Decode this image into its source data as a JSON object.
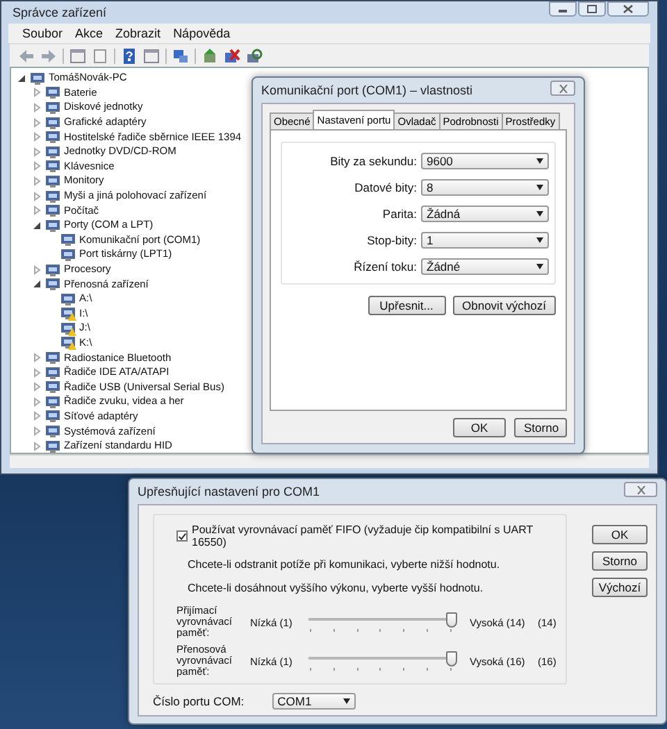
{
  "device_manager": {
    "title": "Správce zařízení",
    "menu": [
      "Soubor",
      "Akce",
      "Zobrazit",
      "Nápověda"
    ],
    "tree": {
      "label": "TomášNovák-PC",
      "expanded": true,
      "children": [
        {
          "label": "Baterie",
          "expanded": false
        },
        {
          "label": "Diskové jednotky",
          "expanded": false
        },
        {
          "label": "Grafické adaptéry",
          "expanded": false
        },
        {
          "label": "Hostitelské řadiče sběrnice IEEE 1394",
          "expanded": false
        },
        {
          "label": "Jednotky DVD/CD-ROM",
          "expanded": false
        },
        {
          "label": "Klávesnice",
          "expanded": false
        },
        {
          "label": "Monitory",
          "expanded": false
        },
        {
          "label": "Myši a jiná polohovací zařízení",
          "expanded": false
        },
        {
          "label": "Počítač",
          "expanded": false
        },
        {
          "label": "Porty (COM a LPT)",
          "expanded": true,
          "children": [
            {
              "label": "Komunikační port (COM1)",
              "warning": false
            },
            {
              "label": "Port tiskárny (LPT1)",
              "warning": false
            }
          ]
        },
        {
          "label": "Procesory",
          "expanded": false
        },
        {
          "label": "Přenosná zařízení",
          "expanded": true,
          "children": [
            {
              "label": "A:\\",
              "warning": false
            },
            {
              "label": "I:\\",
              "warning": true
            },
            {
              "label": "J:\\",
              "warning": true
            },
            {
              "label": "K:\\",
              "warning": true
            }
          ]
        },
        {
          "label": "Radiostanice Bluetooth",
          "expanded": false
        },
        {
          "label": "Řadiče IDE ATA/ATAPI",
          "expanded": false
        },
        {
          "label": "Řadiče USB (Universal Serial Bus)",
          "expanded": false
        },
        {
          "label": "Řadiče zvuku, videa a her",
          "expanded": false
        },
        {
          "label": "Síťové adaptéry",
          "expanded": false
        },
        {
          "label": "Systémová zařízení",
          "expanded": false
        },
        {
          "label": "Zařízení standardu HID",
          "expanded": false
        }
      ]
    }
  },
  "properties_dialog": {
    "title": "Komunikační port (COM1) – vlastnosti",
    "tabs": [
      {
        "label": "Obecné",
        "selected": false
      },
      {
        "label": "Nastavení portu",
        "selected": true
      },
      {
        "label": "Ovladač",
        "selected": false
      },
      {
        "label": "Podrobnosti",
        "selected": false
      },
      {
        "label": "Prostředky",
        "selected": false
      }
    ],
    "fields": [
      {
        "label": "Bity za sekundu:",
        "value": "9600"
      },
      {
        "label": "Datové bity:",
        "value": "8"
      },
      {
        "label": "Parita:",
        "value": "Žádná"
      },
      {
        "label": "Stop-bity:",
        "value": "1"
      },
      {
        "label": "Řízení toku:",
        "value": "Žádné"
      }
    ],
    "actions": [
      "Upřesnit...",
      "Obnovit výchozí"
    ],
    "buttons": [
      "OK",
      "Storno"
    ]
  },
  "advanced_dialog": {
    "title": "Upřesňující nastavení pro COM1",
    "fifo": {
      "label": "Používat vyrovnávací paměť FIFO (vyžaduje čip kompatibilní s UART 16550)",
      "checked": true
    },
    "hints": [
      "Chcete-li odstranit potíže při komunikaci, vyberte nižší hodnotu.",
      "Chcete-li dosáhnout vyššího výkonu, vyberte vyšší hodnotu."
    ],
    "sliders": [
      {
        "label": "Přijímací vyrovnávací paměť:",
        "low": "Nízká (1)",
        "high": "Vysoká (14)",
        "reading": "(14)",
        "level": 1
      },
      {
        "label": "Přenosová vyrovnávací paměť:",
        "low": "Nízká (1)",
        "high": "Vysoká (16)",
        "reading": "(16)",
        "level": 1
      }
    ],
    "port": {
      "label": "Číslo portu COM:",
      "value": "COM1"
    },
    "buttons": [
      "OK",
      "Storno",
      "Výchozí"
    ]
  }
}
